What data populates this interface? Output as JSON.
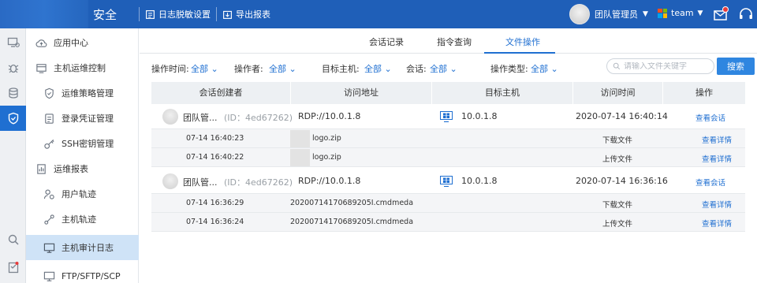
{
  "header": {
    "brand_suffix": "安全",
    "btn_desensitize": "日志脱敏设置",
    "btn_export": "导出报表",
    "user_name": "团队管理员",
    "team_name": "team",
    "colors": {
      "bar": "#1f5fb8",
      "accent": "#1f6fd1",
      "active_menu": "#cfe3f7"
    }
  },
  "rail": {
    "icons": [
      "monitor-link-icon",
      "bug-icon",
      "database-icon",
      "shield-icon",
      "search-icon",
      "checklist-icon"
    ]
  },
  "sidebar": {
    "items": [
      {
        "label": "应用中心",
        "icon": "cloud-icon"
      },
      {
        "label": "主机运维控制",
        "icon": "host-icon"
      },
      {
        "label": "运维策略管理",
        "icon": "shield-outline-icon"
      },
      {
        "label": "登录凭证管理",
        "icon": "credential-icon"
      },
      {
        "label": "SSH密钥管理",
        "icon": "key-icon"
      },
      {
        "label": "运维报表",
        "icon": "report-icon"
      },
      {
        "label": "用户轨迹",
        "icon": "user-track-icon"
      },
      {
        "label": "主机轨迹",
        "icon": "host-track-icon"
      },
      {
        "label": "主机审计日志",
        "icon": "monitor-icon"
      },
      {
        "label": "FTP/SFTP/SCP",
        "icon": "ftp-icon"
      }
    ]
  },
  "tabs": [
    "会话记录",
    "指令查询",
    "文件操作"
  ],
  "filters": {
    "op_time_label": "操作时间:",
    "op_user_label": "操作者:",
    "target_label": "目标主机:",
    "session_label": "会话:",
    "op_type_label": "操作类型:",
    "all": "全部",
    "search_placeholder": "请输入文件关键字",
    "search_button": "搜索"
  },
  "table": {
    "headers": [
      "会话创建者",
      "访问地址",
      "目标主机",
      "访问时间",
      "操作"
    ],
    "groups": [
      {
        "creator": "团队管...",
        "id": "(ID：4ed67262)",
        "address": "RDP://10.0.1.8",
        "host": "10.0.1.8",
        "time": "2020-07-14  16:40:14",
        "action": "查看会话",
        "details": [
          {
            "time": "07-14 16:40:23",
            "file": "logo.zip",
            "type": "下载文件",
            "action": "查看详情"
          },
          {
            "time": "07-14 16:40:22",
            "file": "logo.zip",
            "type": "上传文件",
            "action": "查看详情"
          }
        ]
      },
      {
        "creator": "团队管...",
        "id": "(ID：4ed67262)",
        "address": "RDP://10.0.1.8",
        "host": "10.0.1.8",
        "time": "2020-07-14  16:36:16",
        "action": "查看会话",
        "details": [
          {
            "time": "07-14 16:36:29",
            "file": "20200714170689205I.cmdmeda",
            "type": "下载文件",
            "action": "查看详情"
          },
          {
            "time": "07-14 16:36:24",
            "file": "20200714170689205I.cmdmeda",
            "type": "上传文件",
            "action": "查看详情"
          }
        ]
      }
    ]
  }
}
